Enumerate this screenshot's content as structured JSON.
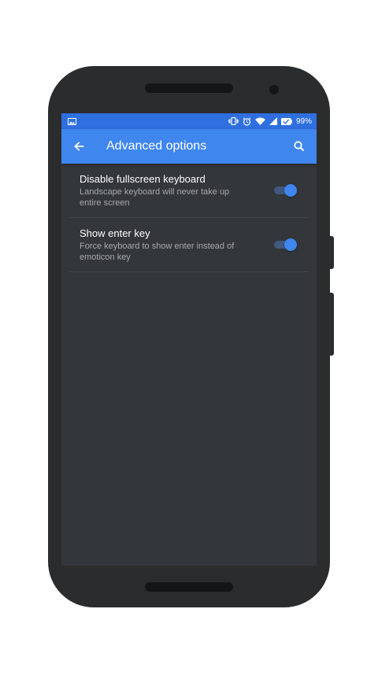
{
  "status_bar": {
    "battery_percent": "99%",
    "icons": [
      "image-icon",
      "vibrate-icon",
      "alarm-icon",
      "wifi-icon",
      "signal-icon",
      "battery-icon"
    ]
  },
  "app_bar": {
    "title": "Advanced options",
    "back_icon": "arrow-back-icon",
    "search_icon": "search-icon"
  },
  "settings": [
    {
      "label": "Disable fullscreen keyboard",
      "description": "Landscape keyboard will never take up entire screen",
      "enabled": true
    },
    {
      "label": "Show enter key",
      "description": "Force keyboard to show enter instead of emoticon key",
      "enabled": true
    }
  ],
  "colors": {
    "accent": "#3f86ee",
    "status_bar": "#2f6fe0",
    "background": "#33363b",
    "toggle_track": "#42587e"
  }
}
